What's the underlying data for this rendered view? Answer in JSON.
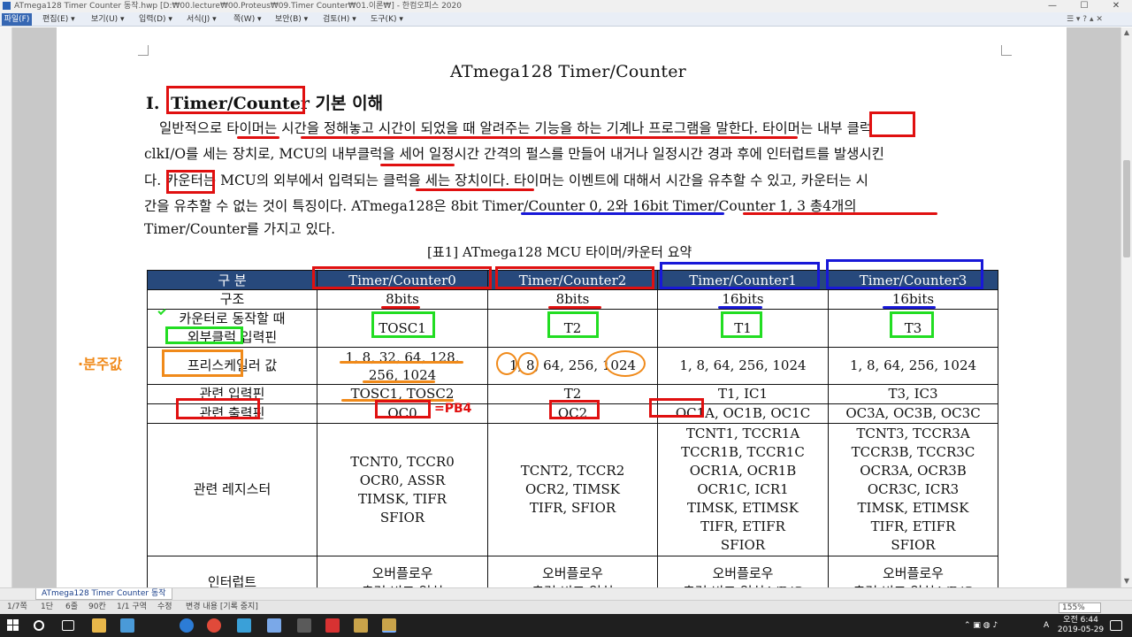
{
  "window": {
    "title": "ATmega128 Timer Counter 동작.hwp [D:₩00.lecture₩00.Proteus₩09.Timer Counter₩01.이론₩] - 한컴오피스 2020",
    "minimize": "—",
    "maximize": "☐",
    "close": "✕"
  },
  "menu": {
    "file": "파일(F)",
    "items": [
      "편집(E) ▾",
      "보기(U) ▾",
      "입력(D) ▾",
      "서식(J) ▾",
      "쪽(W) ▾",
      "보안(B) ▾",
      "검토(H) ▾",
      "도구(K) ▾"
    ],
    "right_controls": "☰ ▾  ? ▴  ✕"
  },
  "document": {
    "title": "ATmega128  Timer/Counter",
    "section_number": "Ⅰ.",
    "section_name": "Timer/Counter",
    "section_suffix": " 기본  이해",
    "paragraph": [
      "일반적으로  타이머는  시간을  정해놓고  시간이  되었을  때  알려주는  기능을  하는  기계나  프로그램을  말한다.  타이머는  내부  클럭",
      "clkI/O를  세는  장치로,  MCU의  내부클럭을  세어  일정시간  간격의  펄스를  만들어  내거나  일정시간  경과  후에  인터럽트를  발생시킨",
      "다.  카운터는  MCU의  외부에서  입력되는  클럭을  세는  장치이다.  타이머는  이벤트에  대해서  시간을  유추할  수  있고,  카운터는  시",
      "간을  유추할  수  없는  것이  특징이다.  ATmega128은  8bit  Timer/Counter  0,  2와  16bit  Timer/Counter  1,  3  총4개의",
      "Timer/Counter를  가지고  있다."
    ],
    "table_caption": "[표1] ATmega128 MCU 타이머/카운터 요약",
    "table": {
      "headers": [
        "구  분",
        "Timer/Counter0",
        "Timer/Counter2",
        "Timer/Counter1",
        "Timer/Counter3"
      ],
      "rows": [
        {
          "label": "구조",
          "cells": [
            "8bits",
            "8bits",
            "16bits",
            "16bits"
          ]
        },
        {
          "label": "카운터로 동작할 때",
          "label2": "외부클럭 입력핀",
          "cells": [
            "TOSC1",
            "T2",
            "T1",
            "T3"
          ]
        },
        {
          "label": "프리스케일러 값",
          "cells": [
            "1, 8, 32, 64, 128, 256, 1024",
            "1, 8, 64, 256, 1024",
            "1, 8, 64, 256, 1024",
            "1, 8, 64, 256, 1024"
          ]
        },
        {
          "label": "관련 입력핀",
          "cells": [
            "TOSC1, TOSC2",
            "T2",
            "T1, IC1",
            "T3, IC3"
          ]
        },
        {
          "label": "관련 출력핀",
          "cells": [
            "OC0",
            "OC2",
            "OC1A, OC1B, OC1C",
            "OC3A, OC3B, OC3C"
          ]
        },
        {
          "label": "관련 레지스터",
          "cells": [
            "TCNT0, TCCR0\nOCR0, ASSR\nTIMSK, TIFR\nSFIOR",
            "TCNT2, TCCR2\nOCR2, TIMSK\nTIFR, SFIOR",
            "TCNT1, TCCR1A\nTCCR1B, TCCR1C\nOCR1A, OCR1B\nOCR1C, ICR1\nTIMSK, ETIMSK\nTIFR, ETIFR\nSFIOR",
            "TCNT3, TCCR3A\nTCCR3B, TCCR3C\nOCR3A, OCR3B\nOCR3C, ICR3\nTIMSK, ETIMSK\nTIFR, ETIFR\nSFIOR"
          ]
        },
        {
          "label": "인터럽트",
          "cells": [
            "오버플로우\n출력 비교 일치",
            "오버플로우\n출력 비교 일치",
            "오버플로우\n출력 비교 일치A/B/C",
            "오버플로우\n출력 비교 일치A/B/C"
          ]
        }
      ]
    }
  },
  "annotations": {
    "prescaler_note": "·분주값",
    "oc0_note": "=PB4"
  },
  "tabs": {
    "document_tab": "ATmega128 Timer Counter 동작"
  },
  "status": {
    "page": "1/7쪽",
    "section": "1단",
    "line": "6줄",
    "col": "90칸",
    "area": "1/1 구역",
    "mode": "수정",
    "change": "변경 내용 [기록 중지]",
    "zoom": "155%"
  },
  "taskbar": {
    "time": "오전 6:44",
    "date": "2019-05-29",
    "ime": "A"
  },
  "colors": {
    "table_header_bg": "#27497c",
    "markup_red": "#e01010",
    "markup_blue": "#1818d8",
    "markup_green": "#22dd22",
    "markup_orange": "#f08a1a"
  }
}
